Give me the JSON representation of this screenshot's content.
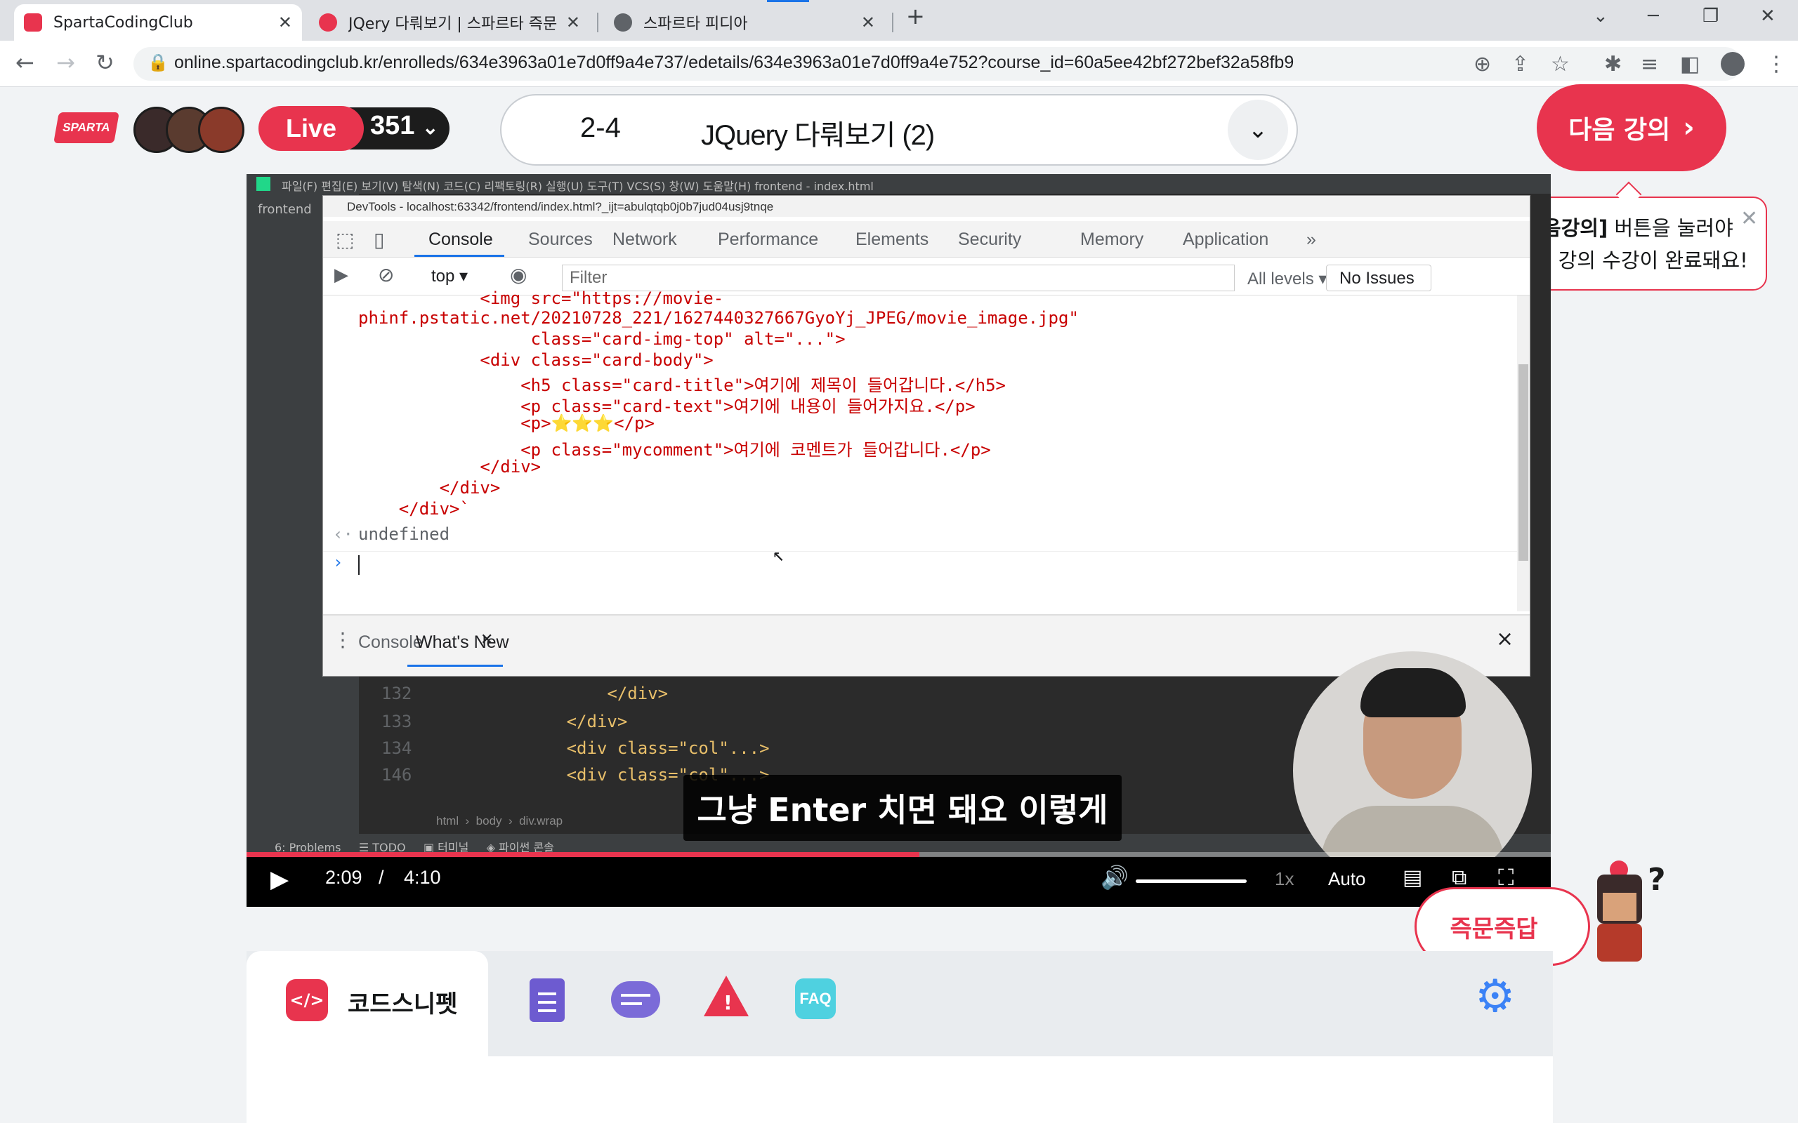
{
  "browser": {
    "tabs": [
      {
        "title": "SpartaCodingClub",
        "active": true
      },
      {
        "title": "JQery 다뤄보기 | 스파르타 즉문",
        "active": false
      },
      {
        "title": "스파르타 피디아",
        "active": false
      }
    ],
    "new_tab": "+",
    "url": "online.spartacodingclub.kr/enrolleds/634e3963a01e7d0ff9a4e737/edetails/634e3963a01e7d0ff9a4e752?course_id=60a5ee42bf272bef32a58fb9"
  },
  "header": {
    "logo_text": "SPARTA",
    "live_label": "Live",
    "live_count": "351",
    "lesson_number": "2-4",
    "lesson_title": "JQuery 다뤄보기 (2)",
    "next_button": "다음 강의",
    "tooltip_bold": "[다음강의]",
    "tooltip_rest": " 버튼을 눌러야",
    "tooltip_line2": "이번 강의 수강이 완료돼요!"
  },
  "video": {
    "ide_menu": "파일(F)  편집(E)  보기(V)  탐색(N)  코드(C)  리팩토링(R)  실행(U)  도구(T)  VCS(S)  창(W)  도움말(H)     frontend - index.html",
    "ide_project": "frontend",
    "devtools": {
      "window_title": "DevTools - localhost:63342/frontend/index.html?_ijt=abulqtqb0j0b7jud04usj9tnqe",
      "tabs": [
        "Console",
        "Sources",
        "Network",
        "Performance",
        "Elements",
        "Security",
        "Memory",
        "Application"
      ],
      "more_tabs": "»",
      "context": "top",
      "filter_placeholder": "Filter",
      "levels": "All levels",
      "issues": "No Issues",
      "console_lines": [
        "            <img src=\"https://movie-",
        "phinf.pstatic.net/20210728_221/1627440327667GyoYj_JPEG/movie_image.jpg\"",
        "                 class=\"card-img-top\" alt=\"...\">",
        "            <div class=\"card-body\">",
        "                <h5 class=\"card-title\">여기에 제목이 들어갑니다.</h5>",
        "                <p class=\"card-text\">여기에 내용이 들어가지요.</p>",
        "                <p>⭐⭐⭐</p>",
        "                <p class=\"mycomment\">여기에 코멘트가 들어갑니다.</p>",
        "            </div>",
        "        </div>",
        "    </div>`"
      ],
      "result": "undefined",
      "drawer_tabs": [
        "Console",
        "What's New"
      ],
      "drawer_close": "×"
    },
    "code_lines": [
      {
        "num": "132",
        "code": "            </div>"
      },
      {
        "num": "133",
        "code": "        </div>"
      },
      {
        "num": "134",
        "code": "        <div class=\"col\"...>"
      },
      {
        "num": "146",
        "code": "        <div class=\"col\"...>"
      }
    ],
    "breadcrumb": "html  ›  body  ›  div.wrap",
    "ide_status": "6: Problems     ☰ TODO     ▣ 터미널     ◈ 파이썬 콘솔",
    "subtitle": "그냥 Enter 치면 돼요 이렇게",
    "current_time": "2:09",
    "separator": "/",
    "duration": "4:10",
    "speed": "1x",
    "quality": "Auto",
    "progress": 0.516
  },
  "qa_button": "즉문즉답",
  "bottom_panel": {
    "active_tab": "코드스니펫",
    "faq": "FAQ"
  },
  "colors": {
    "brand": "#e8344e",
    "live_dark": "#1c1c1c",
    "purple": "#6d5bd0",
    "teal": "#4fd1e0",
    "blue": "#3b82f6"
  }
}
